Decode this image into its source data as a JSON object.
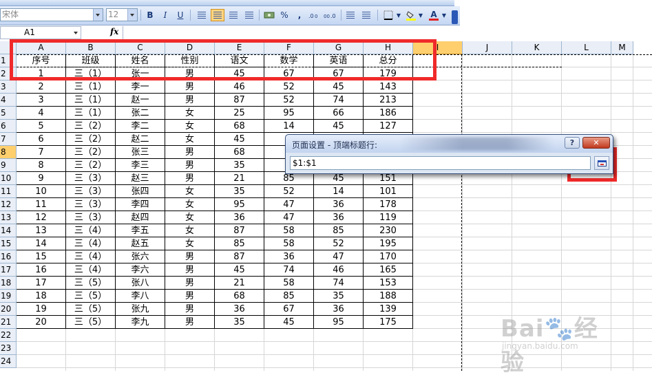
{
  "toolbar": {
    "font_name": "宋体",
    "font_size": "12",
    "bold": "B",
    "italic": "I",
    "underline": "U",
    "percent": "%",
    "thousands": ",",
    "font_color_label": "A"
  },
  "formula_bar": {
    "name_box": "A1",
    "fx": "fx",
    "content": ""
  },
  "sheet": {
    "columns": [
      "A",
      "B",
      "C",
      "D",
      "E",
      "F",
      "G",
      "H",
      "I",
      "J",
      "K",
      "L",
      "M"
    ],
    "rows": [
      "1",
      "2",
      "3",
      "4",
      "5",
      "6",
      "7",
      "8",
      "9",
      "10",
      "11",
      "12",
      "13",
      "14",
      "15",
      "16",
      "17",
      "18",
      "19",
      "20",
      "21",
      "22",
      "23",
      "24"
    ],
    "header_row": [
      "序号",
      "班级",
      "姓名",
      "性别",
      "语文",
      "数学",
      "英语",
      "总分"
    ],
    "data": [
      [
        "1",
        "三（1）",
        "张一",
        "男",
        "45",
        "67",
        "67",
        "179"
      ],
      [
        "2",
        "三（1）",
        "李一",
        "男",
        "46",
        "52",
        "45",
        "143"
      ],
      [
        "3",
        "三（1）",
        "赵一",
        "男",
        "87",
        "52",
        "74",
        "213"
      ],
      [
        "4",
        "三（1）",
        "张二",
        "女",
        "25",
        "95",
        "66",
        "186"
      ],
      [
        "5",
        "三（2）",
        "李二",
        "女",
        "68",
        "14",
        "45",
        "127"
      ],
      [
        "6",
        "三（2）",
        "赵二",
        "女",
        "45",
        "",
        "",
        ""
      ],
      [
        "7",
        "三（2）",
        "张三",
        "男",
        "68",
        "",
        "",
        ""
      ],
      [
        "8",
        "三（2）",
        "李三",
        "男",
        "35",
        "",
        "",
        ""
      ],
      [
        "9",
        "三（3）",
        "赵三",
        "男",
        "21",
        "85",
        "45",
        "151"
      ],
      [
        "10",
        "三（3）",
        "张四",
        "女",
        "35",
        "52",
        "14",
        "101"
      ],
      [
        "11",
        "三（3）",
        "李四",
        "女",
        "95",
        "47",
        "36",
        "178"
      ],
      [
        "12",
        "三（3）",
        "赵四",
        "女",
        "36",
        "47",
        "36",
        "119"
      ],
      [
        "13",
        "三（4）",
        "李五",
        "女",
        "87",
        "58",
        "85",
        "230"
      ],
      [
        "14",
        "三（4）",
        "赵五",
        "女",
        "85",
        "58",
        "52",
        "195"
      ],
      [
        "15",
        "三（4）",
        "张六",
        "男",
        "87",
        "36",
        "47",
        "170"
      ],
      [
        "16",
        "三（4）",
        "李六",
        "男",
        "45",
        "74",
        "46",
        "165"
      ],
      [
        "17",
        "三（5）",
        "张八",
        "男",
        "21",
        "58",
        "74",
        "153"
      ],
      [
        "18",
        "三（5）",
        "李八",
        "男",
        "68",
        "85",
        "35",
        "188"
      ],
      [
        "19",
        "三（5）",
        "张九",
        "男",
        "36",
        "67",
        "36",
        "139"
      ],
      [
        "20",
        "三（5）",
        "李九",
        "男",
        "35",
        "45",
        "95",
        "175"
      ]
    ]
  },
  "dialog": {
    "title": "页面设置 - 顶端标题行:",
    "help": "?",
    "close": "✕",
    "input_value": "$1:$1"
  },
  "watermark": {
    "main": "Bai🐾经验",
    "sub": "jingyan.baidu.com"
  },
  "colors": {
    "annotation_red": "#f02a2a",
    "selected_header": "#ffcf6e"
  }
}
